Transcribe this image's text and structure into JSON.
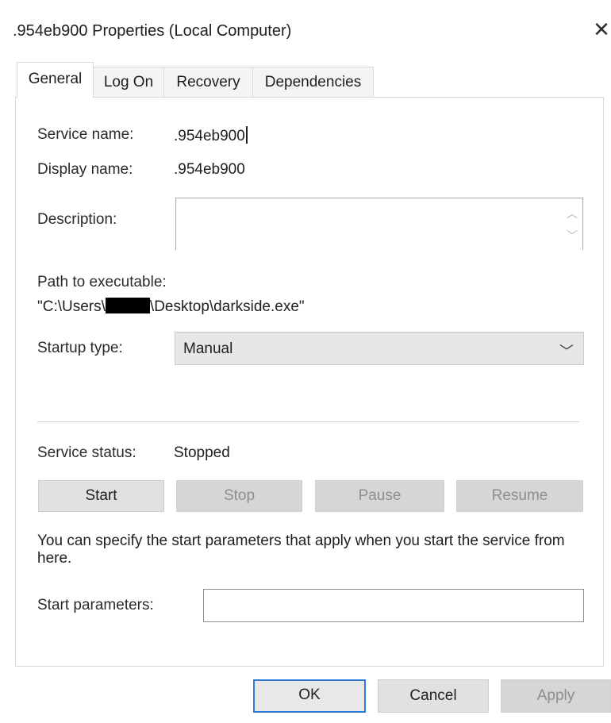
{
  "window": {
    "title": ".954eb900 Properties (Local Computer)",
    "close_glyph": "✕"
  },
  "tabs": [
    {
      "label": "General",
      "active": true
    },
    {
      "label": "Log On",
      "active": false
    },
    {
      "label": "Recovery",
      "active": false
    },
    {
      "label": "Dependencies",
      "active": false
    }
  ],
  "general": {
    "service_name_label": "Service name:",
    "service_name_value": ".954eb900",
    "display_name_label": "Display name:",
    "display_name_value": ".954eb900",
    "description_label": "Description:",
    "description_value": "",
    "path_label": "Path to executable:",
    "path_prefix": "\"C:\\Users\\",
    "path_suffix": "\\Desktop\\darkside.exe\"",
    "startup_type_label": "Startup type:",
    "startup_type_value": "Manual",
    "service_status_label": "Service status:",
    "service_status_value": "Stopped",
    "buttons": {
      "start": "Start",
      "stop": "Stop",
      "pause": "Pause",
      "resume": "Resume"
    },
    "hint_text": "You can specify the start parameters that apply when you start the service from here.",
    "start_params_label": "Start parameters:",
    "start_params_value": ""
  },
  "footer": {
    "ok": "OK",
    "cancel": "Cancel",
    "apply": "Apply"
  },
  "colors": {
    "primary_border": "#2f7ad6",
    "disabled_text": "#8e8e8e"
  }
}
